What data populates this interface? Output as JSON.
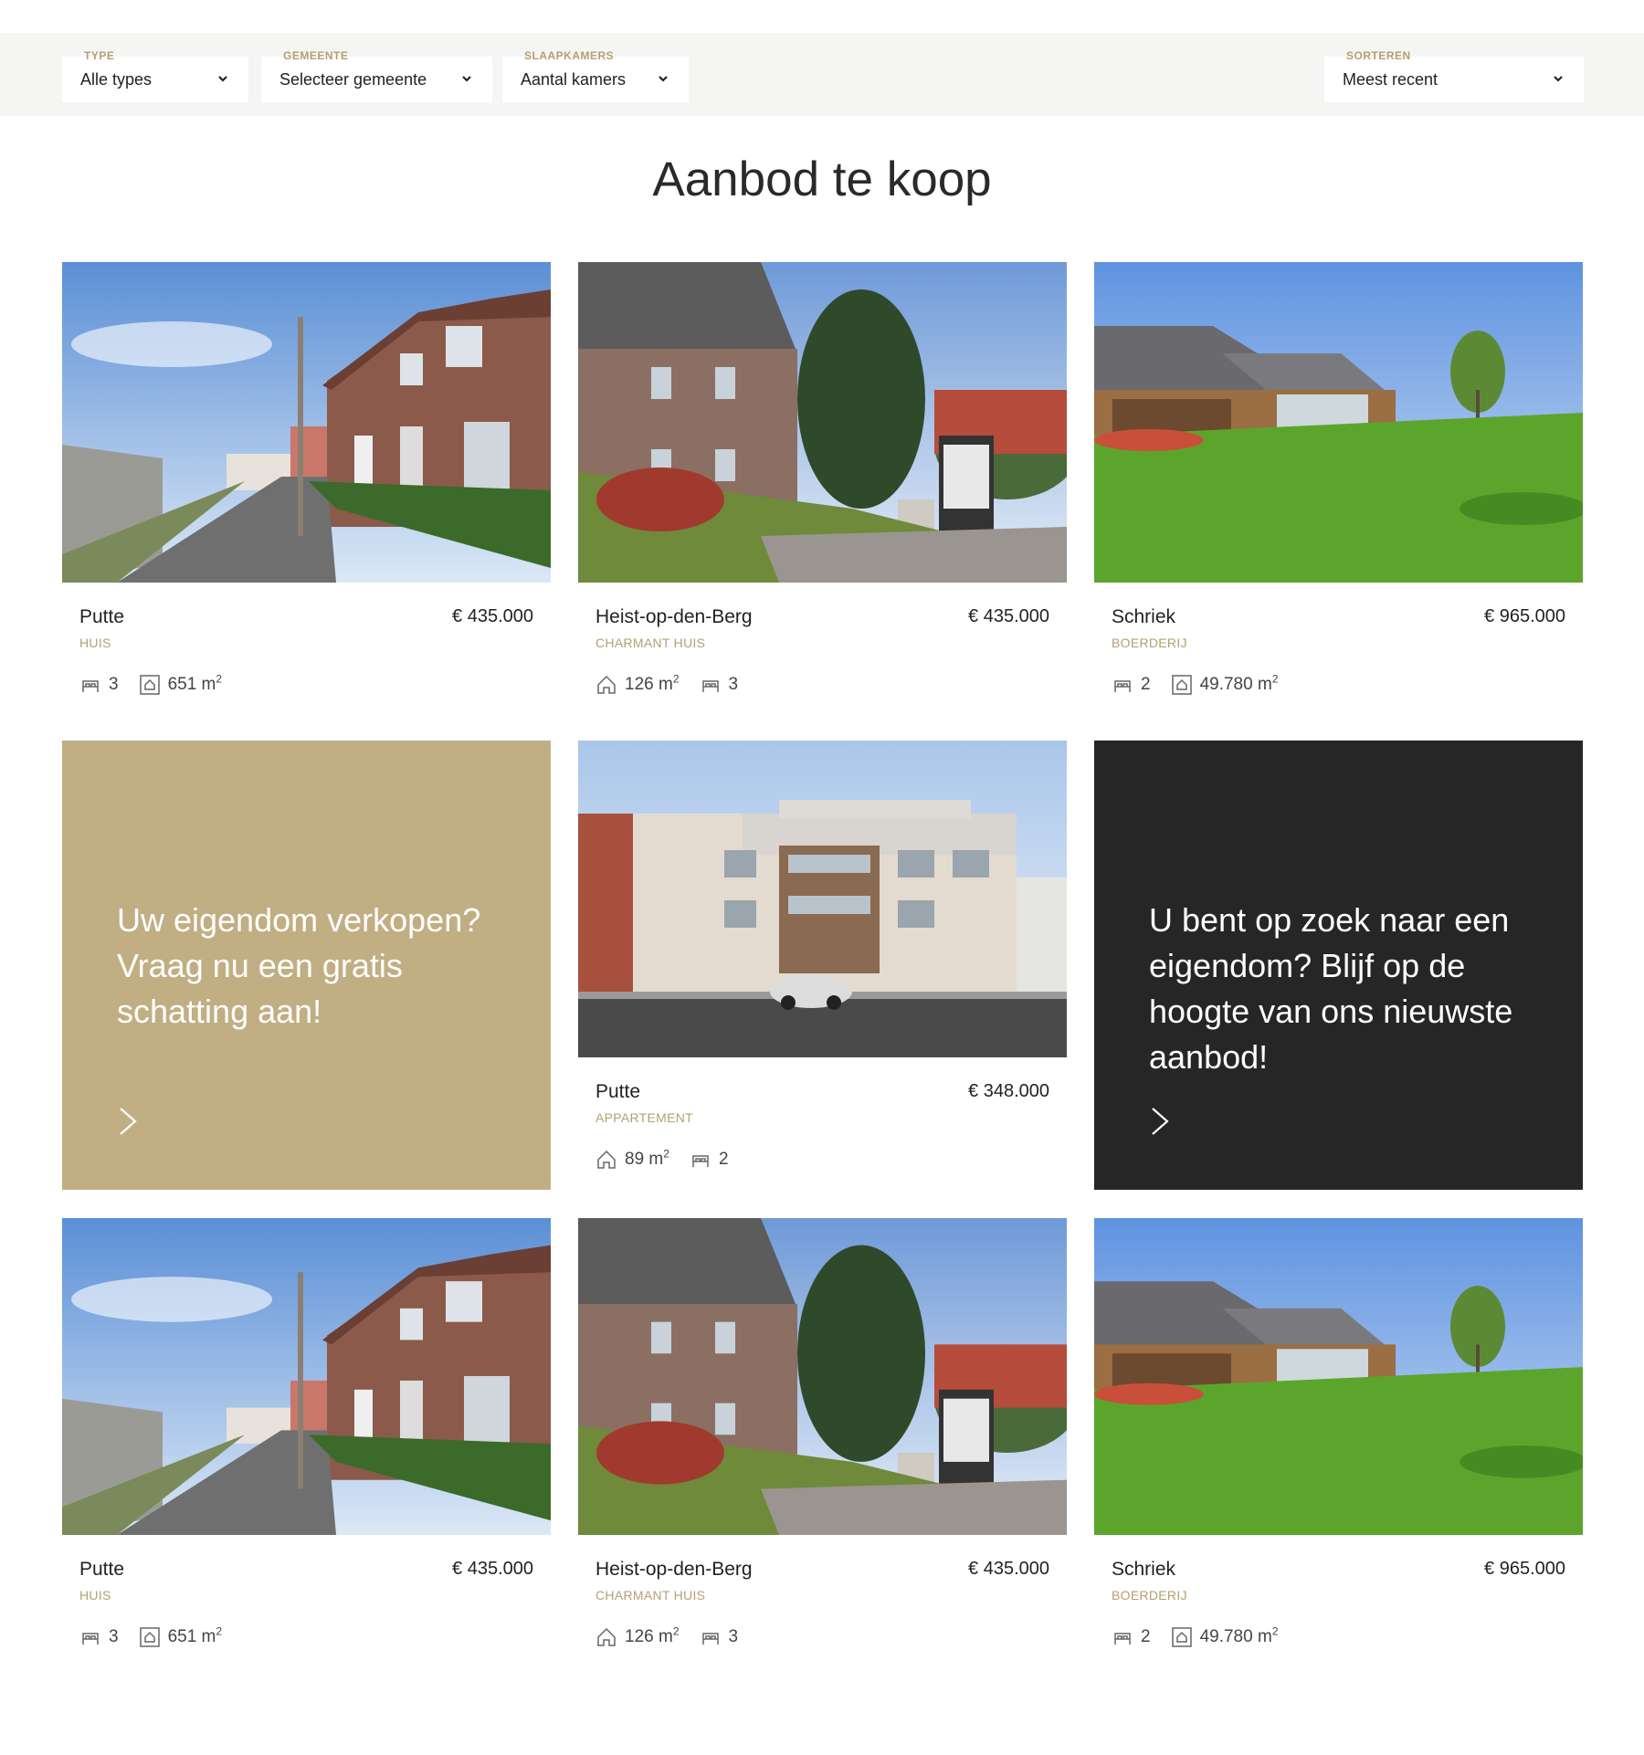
{
  "filters": {
    "type": {
      "label": "TYPE",
      "value": "Alle types"
    },
    "gemeente": {
      "label": "GEMEENTE",
      "value": "Selecteer gemeente"
    },
    "slaapkamers": {
      "label": "SLAAPKAMERS",
      "value": "Aantal kamers"
    },
    "sorteren": {
      "label": "SORTEREN",
      "value": "Meest recent"
    }
  },
  "page_title": "Aanbod te koop",
  "listings": [
    {
      "city": "Putte",
      "price": "€ 435.000",
      "type": "HUIS",
      "specs": [
        {
          "icon": "bed-icon",
          "value": "3"
        },
        {
          "icon": "plot-icon",
          "value": "651 m",
          "unit_sup": "2"
        }
      ]
    },
    {
      "city": "Heist-op-den-Berg",
      "price": "€ 435.000",
      "type": "CHARMANT HUIS",
      "specs": [
        {
          "icon": "house-icon",
          "value": "126 m",
          "unit_sup": "2"
        },
        {
          "icon": "bed-icon",
          "value": "3"
        }
      ]
    },
    {
      "city": "Schriek",
      "price": "€ 965.000",
      "type": "BOERDERIJ",
      "specs": [
        {
          "icon": "bed-icon",
          "value": "2"
        },
        {
          "icon": "plot-icon",
          "value": "49.780 m",
          "unit_sup": "2"
        }
      ]
    },
    {
      "city": "Putte",
      "price": "€ 348.000",
      "type": "APPARTEMENT",
      "specs": [
        {
          "icon": "house-icon",
          "value": "89 m",
          "unit_sup": "2"
        },
        {
          "icon": "bed-icon",
          "value": "2"
        }
      ]
    },
    {
      "city": "Putte",
      "price": "€ 435.000",
      "type": "HUIS",
      "specs": [
        {
          "icon": "bed-icon",
          "value": "3"
        },
        {
          "icon": "plot-icon",
          "value": "651 m",
          "unit_sup": "2"
        }
      ]
    },
    {
      "city": "Heist-op-den-Berg",
      "price": "€ 435.000",
      "type": "CHARMANT HUIS",
      "specs": [
        {
          "icon": "house-icon",
          "value": "126 m",
          "unit_sup": "2"
        },
        {
          "icon": "bed-icon",
          "value": "3"
        }
      ]
    },
    {
      "city": "Schriek",
      "price": "€ 965.000",
      "type": "BOERDERIJ",
      "specs": [
        {
          "icon": "bed-icon",
          "value": "2"
        },
        {
          "icon": "plot-icon",
          "value": "49.780 m",
          "unit_sup": "2"
        }
      ]
    }
  ],
  "promos": {
    "sell": {
      "text": "Uw eigendom verkopen? Vraag nu een gratis schatting aan!",
      "color": "#c1ae83"
    },
    "search": {
      "text": "U bent op zoek naar een eigendom? Blijf op de hoogte van ons nieuwste aanbod!",
      "color": "#262626"
    }
  },
  "colors": {
    "accent": "#b59f72",
    "filterbar": "#f5f5f4"
  }
}
